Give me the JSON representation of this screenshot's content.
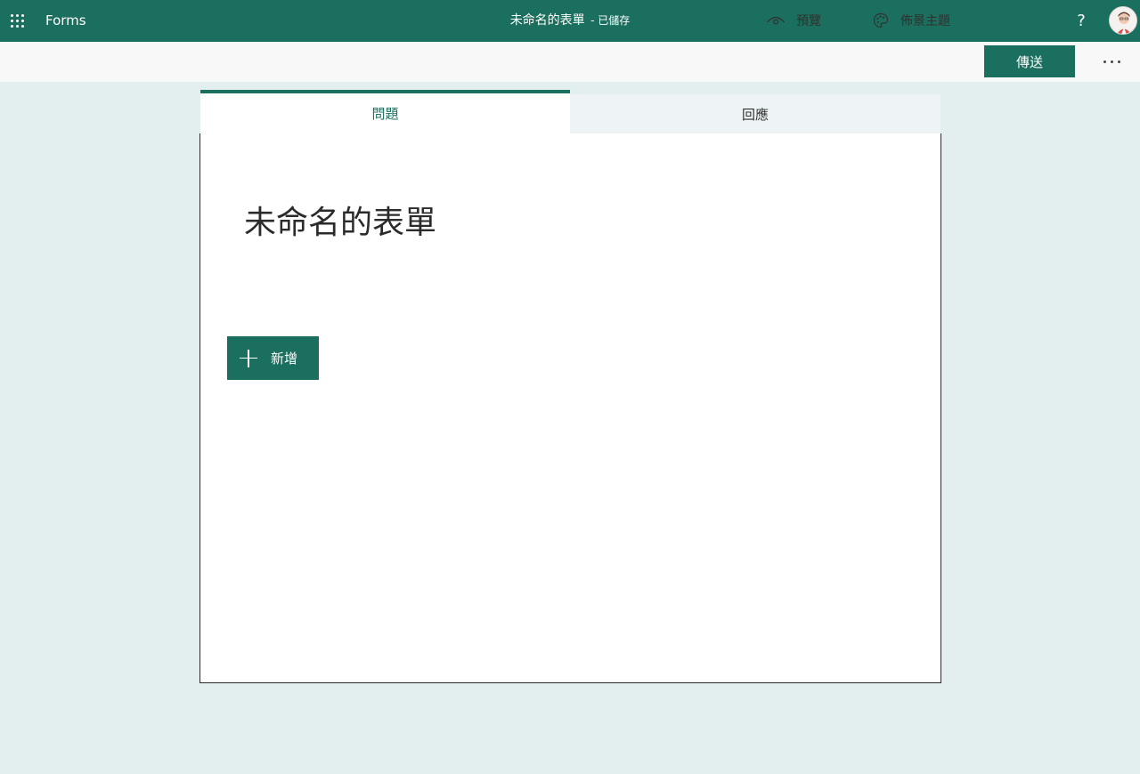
{
  "topbar": {
    "app_name": "Forms",
    "doc_title": "未命名的表單",
    "saved_status": "- 已儲存",
    "help_label": "?",
    "brand_color": "#1b6f5e"
  },
  "commandbar": {
    "preview_label": "預覽",
    "theme_label": "佈景主題",
    "send_label": "傳送",
    "more_icon": "ellipsis-icon"
  },
  "tabs": [
    {
      "label": "問題",
      "active": true
    },
    {
      "label": "回應",
      "active": false
    }
  ],
  "form": {
    "title": "未命名的表單",
    "add_label": "新增"
  }
}
